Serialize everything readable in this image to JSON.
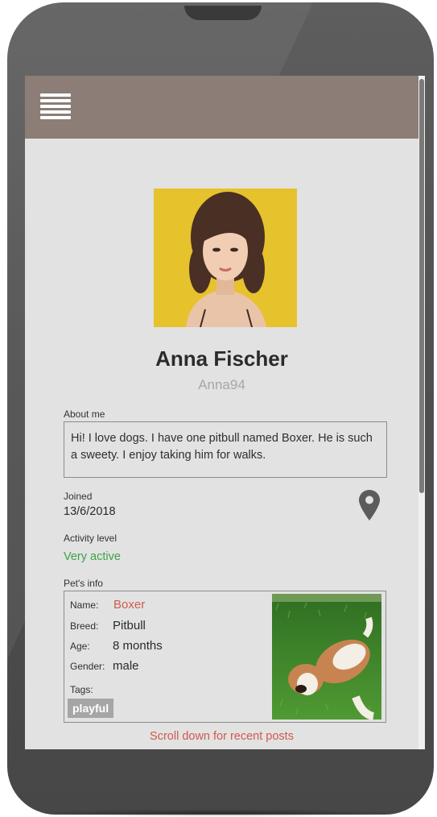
{
  "header": {
    "menu_icon": "hamburger-menu-icon",
    "background": "#8c7d77"
  },
  "profile": {
    "name": "Anna Fischer",
    "username": "Anna94"
  },
  "about": {
    "label": "About me",
    "text": "Hi! I love dogs. I have one pitbull named Boxer. He is such a sweety. I enjoy taking him for walks."
  },
  "joined": {
    "label": "Joined",
    "date": "13/6/2018"
  },
  "location_icon": "map-pin-icon",
  "activity": {
    "label": "Activity level",
    "value": "Very active",
    "color": "#3ea24a"
  },
  "pet": {
    "section_label": "Pet's info",
    "name_key": "Name:",
    "name": "Boxer",
    "breed_key": "Breed:",
    "breed": "Pitbull",
    "age_key": "Age:",
    "age": "8 months",
    "gender_key": "Gender:",
    "gender": "male",
    "tags_key": "Tags:",
    "tags": [
      "playful"
    ]
  },
  "footer": {
    "scroll_hint": "Scroll down for recent posts",
    "accent": "#cf5a4c"
  }
}
